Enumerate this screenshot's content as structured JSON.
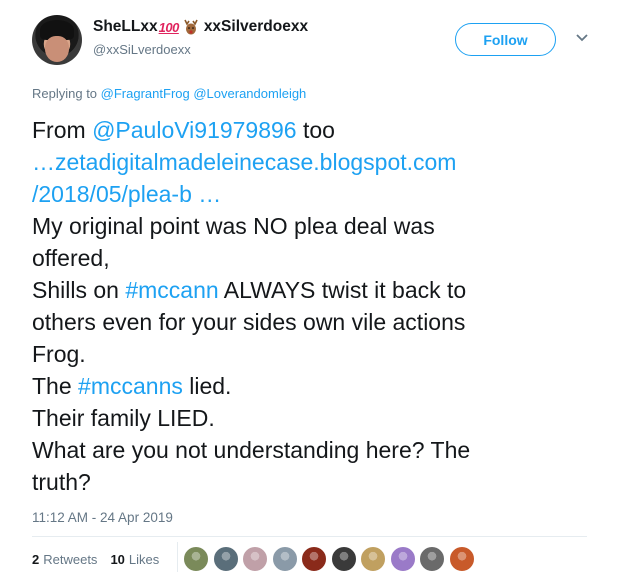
{
  "author": {
    "display_name_prefix": "SheLLxx",
    "hundred_glyph": "100",
    "display_name_suffix": "xxSilverdoexx",
    "handle": "@xxSiLverdoexx"
  },
  "follow_label": "Follow",
  "replying": {
    "prefix": "Replying to",
    "mentions": [
      "@FragrantFrog",
      "@Loverandomleigh"
    ]
  },
  "tweet": {
    "l1_text": "From ",
    "l1_link": "@PauloVi91979896",
    "l1_tail": " too",
    "l2_link": "…zetadigitalmadeleinecase.blogspot.com",
    "l3_link": "/2018/05/plea-b …",
    "l4": "My original point was NO plea deal was",
    "l5": "offered,",
    "l6_text": "Shills on ",
    "l6_tag": "#mccann",
    "l6_tail": " ALWAYS twist it back to",
    "l7": "others even for your sides own vile actions",
    "l8": "Frog.",
    "l9_text": "The ",
    "l9_tag": "#mccanns",
    "l9_tail": " lied.",
    "l10": "Their family LIED.",
    "l11": "What are you not understanding here? The",
    "l12": "truth?"
  },
  "timestamp": "11:12 AM - 24 Apr 2019",
  "stats": {
    "retweets_count": "2",
    "retweets_label": "Retweets",
    "likes_count": "10",
    "likes_label": "Likes"
  },
  "liker_colors": [
    "#7a8a5a",
    "#5a6e7a",
    "#c0a0a8",
    "#8a9aa8",
    "#8a2a1a",
    "#3a3a3a",
    "#c0a060",
    "#9a7ac8",
    "#6a6a6a",
    "#c85a2a"
  ],
  "colors": {
    "accent": "#1da1f2",
    "text": "#14171a",
    "muted": "#657786"
  }
}
